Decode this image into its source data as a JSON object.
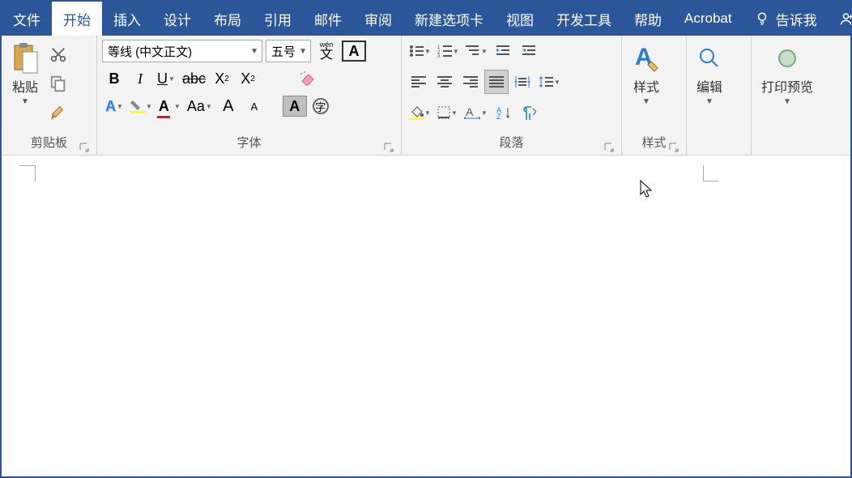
{
  "tabs": {
    "file": "文件",
    "home": "开始",
    "insert": "插入",
    "design": "设计",
    "layout": "布局",
    "references": "引用",
    "mailings": "邮件",
    "review": "审阅",
    "newtab": "新建选项卡",
    "view": "视图",
    "developer": "开发工具",
    "help": "帮助",
    "acrobat": "Acrobat",
    "tell_me": "告诉我",
    "share": "共享"
  },
  "clipboard": {
    "paste": "粘贴",
    "group_label": "剪贴板"
  },
  "font": {
    "name": "等线 (中文正文)",
    "size": "五号",
    "group_label": "字体"
  },
  "paragraph": {
    "group_label": "段落"
  },
  "styles": {
    "button": "样式",
    "group_label": "样式"
  },
  "editing": {
    "button": "编辑"
  },
  "print_preview": {
    "button": "打印预览"
  }
}
